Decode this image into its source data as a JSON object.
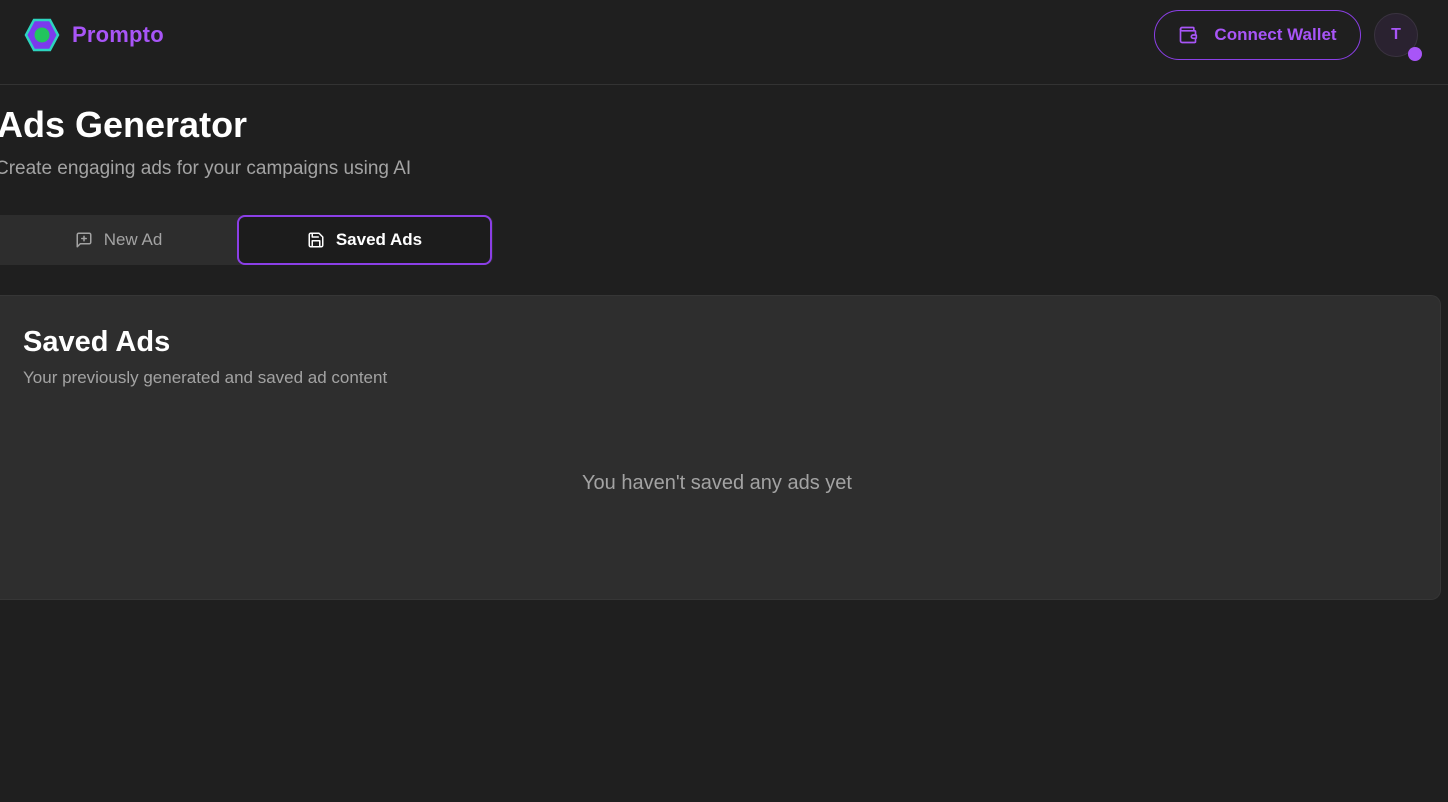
{
  "header": {
    "brand_name": "Prompto",
    "connect_wallet_label": "Connect Wallet",
    "avatar_initial": "T"
  },
  "page": {
    "title": "Ads Generator",
    "subtitle": "Create engaging ads for your campaigns using AI"
  },
  "tabs": [
    {
      "label": "New Ad",
      "icon": "message-square-plus-icon",
      "active": false
    },
    {
      "label": "Saved Ads",
      "icon": "save-icon",
      "active": true
    }
  ],
  "saved_card": {
    "title": "Saved Ads",
    "description": "Your previously generated and saved ad content",
    "empty_message": "You haven't saved any ads yet"
  },
  "colors": {
    "background": "#1f1f1f",
    "accent": "#a855f7",
    "accent_border": "#8b3fe6",
    "logo_teal": "#2dd4bf",
    "logo_green": "#22c55e",
    "muted_text": "#a3a3a3",
    "card_bg": "#2e2e2e"
  }
}
